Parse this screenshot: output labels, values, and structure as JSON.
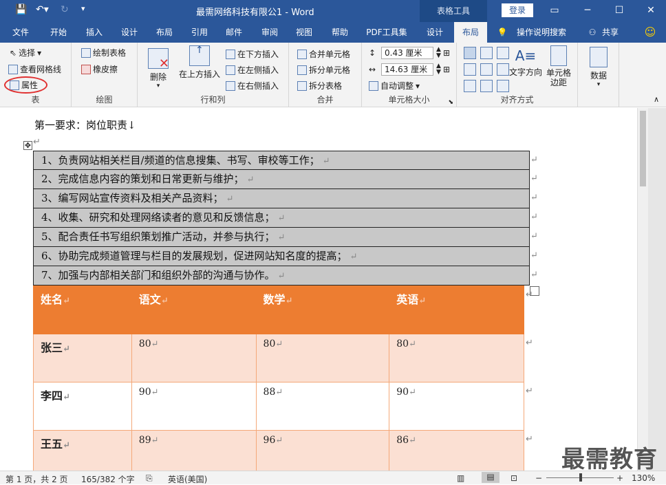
{
  "titlebar": {
    "doc_title": "最需网络科技有限公1  -  Word",
    "context_tools": "表格工具",
    "login": "登录"
  },
  "tabs": [
    {
      "label": "文件"
    },
    {
      "label": "开始"
    },
    {
      "label": "插入"
    },
    {
      "label": "设计"
    },
    {
      "label": "布局"
    },
    {
      "label": "引用"
    },
    {
      "label": "邮件"
    },
    {
      "label": "审阅"
    },
    {
      "label": "视图"
    },
    {
      "label": "帮助"
    },
    {
      "label": "PDF工具集"
    },
    {
      "label": "设计"
    },
    {
      "label": "布局"
    },
    {
      "label": "操作说明搜索"
    },
    {
      "label": "共享"
    }
  ],
  "ribbon": {
    "table": {
      "select": "选择",
      "gridlines": "查看网格线",
      "properties": "属性",
      "label": "表"
    },
    "draw": {
      "draw_table": "绘制表格",
      "eraser": "橡皮擦",
      "label": "绘图"
    },
    "rows_cols": {
      "delete": "删除",
      "insert_above": "在上方插入",
      "insert_below": "在下方插入",
      "insert_left": "在左侧插入",
      "insert_right": "在右侧插入",
      "label": "行和列"
    },
    "merge": {
      "merge_cells": "合并单元格",
      "split_cells": "拆分单元格",
      "split_table": "拆分表格",
      "label": "合并"
    },
    "cell_size": {
      "height": "0.43 厘米",
      "width": "14.63 厘米",
      "autofit": "自动调整",
      "label": "单元格大小"
    },
    "align": {
      "text_direction": "文字方向",
      "margins": "单元格边距",
      "label": "对齐方式"
    },
    "data": {
      "data": "数据"
    }
  },
  "document": {
    "first_req": "第一要求：岗位职责↓",
    "duties": [
      "1、负责网站相关栏目/频道的信息搜集、书写、审校等工作；",
      "2、完成信息内容的策划和日常更新与维护；",
      "3、编写网站宣传资料及相关产品资料；",
      "4、收集、研究和处理网络读者的意见和反馈信息；",
      "5、配合责任书写组织策划推广活动，并参与执行；",
      "6、协助完成频道管理与栏目的发展规划，促进网站知名度的提高；",
      "7、加强与内部相关部门和组织外部的沟通与协作。"
    ],
    "scores": {
      "headers": [
        "姓名",
        "语文",
        "数学",
        "英语"
      ],
      "rows": [
        [
          "张三",
          "80",
          "80",
          "80"
        ],
        [
          "李四",
          "90",
          "88",
          "90"
        ],
        [
          "王五",
          "89",
          "96",
          "86"
        ]
      ]
    }
  },
  "statusbar": {
    "page": "第 1 页，共 2 页",
    "words": "165/382 个字",
    "language": "英语(美国)",
    "zoom": "130%"
  },
  "watermark": "最需教育"
}
